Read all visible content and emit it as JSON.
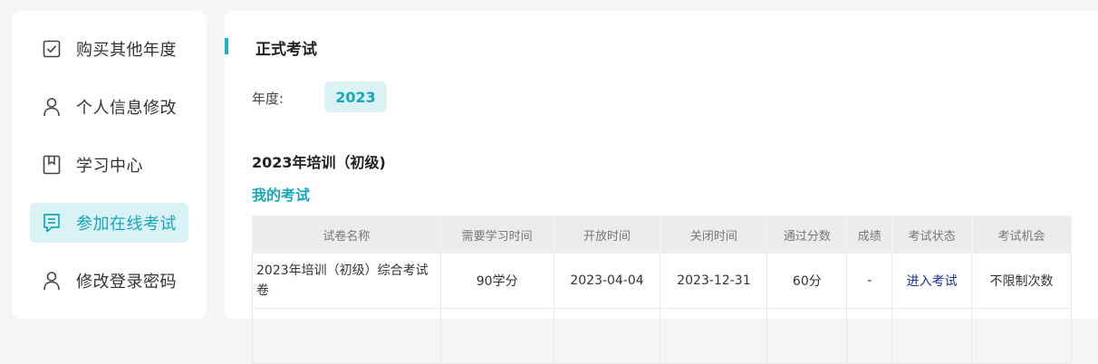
{
  "sidebar": {
    "items": [
      {
        "label": "购买其他年度",
        "icon": "checkbox-icon",
        "active": false
      },
      {
        "label": "个人信息修改",
        "icon": "user-icon",
        "active": false
      },
      {
        "label": "学习中心",
        "icon": "bookmark-icon",
        "active": false
      },
      {
        "label": "参加在线考试",
        "icon": "message-icon",
        "active": true
      },
      {
        "label": "修改登录密码",
        "icon": "user-icon",
        "active": false
      }
    ]
  },
  "main": {
    "title": "正式考试",
    "year_label": "年度:",
    "year_value": "2023",
    "section_title": "2023年培训（初级)",
    "sub_title": "我的考试",
    "table": {
      "headers": [
        "试卷名称",
        "需要学习时间",
        "开放时间",
        "关闭时间",
        "通过分数",
        "成绩",
        "考试状态",
        "考试机会"
      ],
      "rows": [
        {
          "name": "2023年培训（初级）综合考试卷",
          "study_time": "90学分",
          "open_time": "2023-04-04",
          "close_time": "2023-12-31",
          "pass_score": "60分",
          "score": "-",
          "status": "进入考试",
          "chances": "不限制次数"
        }
      ]
    }
  },
  "colors": {
    "accent": "#16a7b9",
    "active_bg": "#d9f2f5",
    "link": "#1a2fa0"
  }
}
